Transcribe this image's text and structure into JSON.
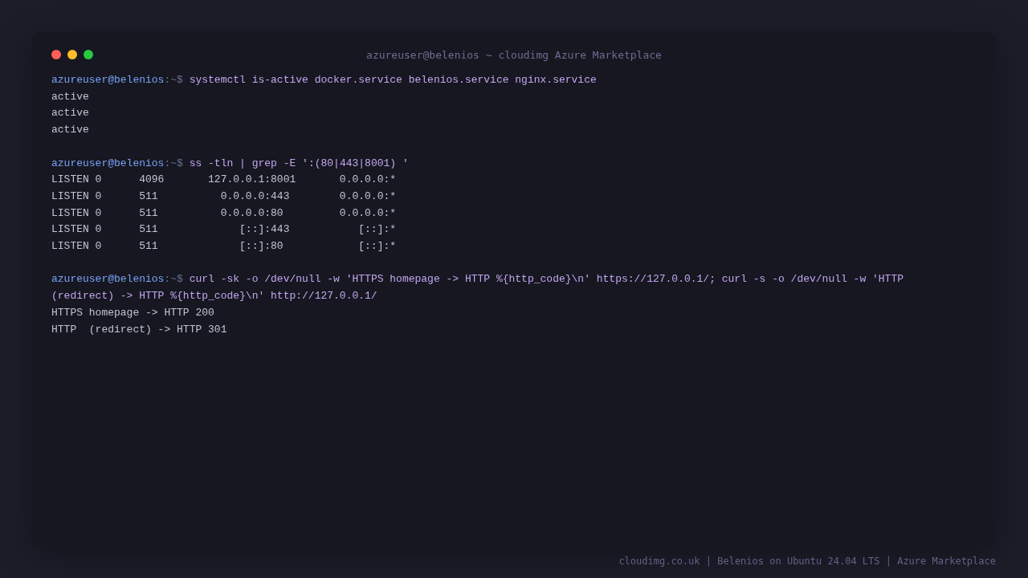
{
  "window": {
    "title": "azureuser@belenios ~ cloudimg Azure Marketplace"
  },
  "blocks": [
    {
      "prompt": "azureuser@belenios",
      "path": ":~$",
      "command": "systemctl is-active docker.service belenios.service nginx.service",
      "output": [
        "active",
        "active",
        "active"
      ]
    },
    {
      "prompt": "azureuser@belenios",
      "path": ":~$",
      "command": "ss -tln | grep -E ':(80|443|8001) '",
      "output": [
        "LISTEN 0      4096       127.0.0.1:8001       0.0.0.0:*",
        "LISTEN 0      511          0.0.0.0:443        0.0.0.0:*",
        "LISTEN 0      511          0.0.0.0:80         0.0.0.0:*",
        "LISTEN 0      511             [::]:443           [::]:*",
        "LISTEN 0      511             [::]:80            [::]:*"
      ]
    },
    {
      "prompt": "azureuser@belenios",
      "path": ":~$",
      "command": "curl -sk -o /dev/null -w 'HTTPS homepage -> HTTP %{http_code}\\n' https://127.0.0.1/; curl -s -o /dev/null -w 'HTTP",
      "command_continued": "(redirect) -> HTTP %{http_code}\\n' http://127.0.0.1/",
      "output": [
        "HTTPS homepage -> HTTP 200",
        "HTTP  (redirect) -> HTTP 301"
      ]
    }
  ],
  "footer": "cloudimg.co.uk | Belenios on Ubuntu 24.04 LTS | Azure Marketplace"
}
